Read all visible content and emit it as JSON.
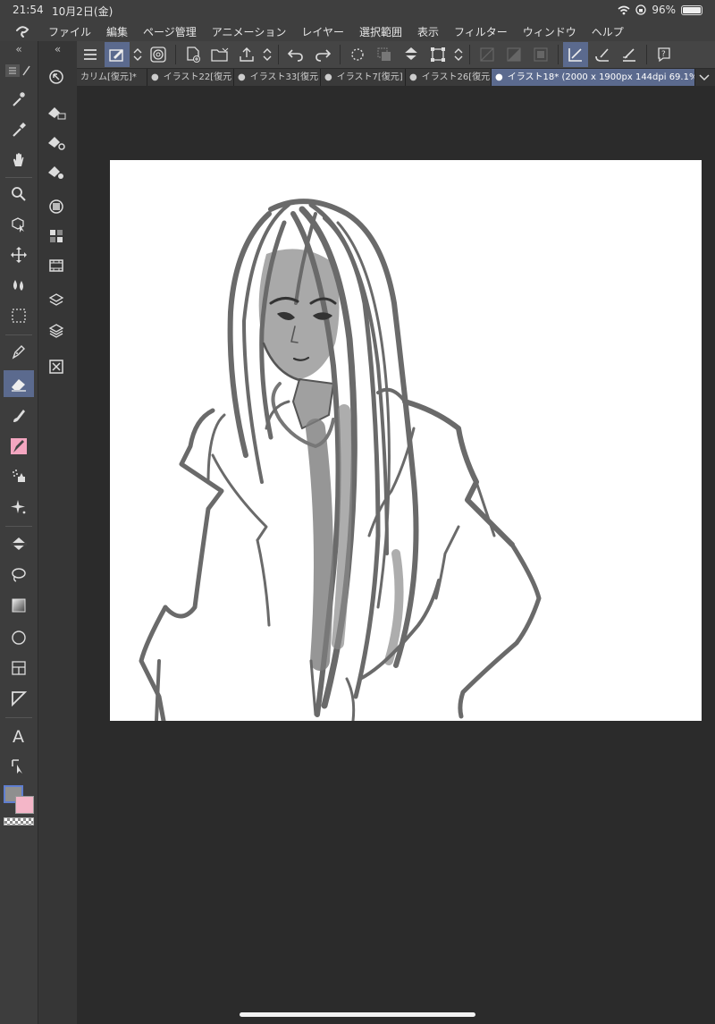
{
  "status_bar": {
    "time": "21:54",
    "date": "10月2日(金)",
    "battery": "96%",
    "battery_level": 0.96
  },
  "menu": {
    "items": [
      "ファイル",
      "編集",
      "ページ管理",
      "アニメーション",
      "レイヤー",
      "選択範囲",
      "表示",
      "フィルター",
      "ウィンドウ",
      "ヘルプ"
    ]
  },
  "panels": {
    "collapse_left": "«",
    "collapse_second": "«"
  },
  "tabs": [
    {
      "label": "カリム[復元]*",
      "dot": ""
    },
    {
      "label": "イラスト22[復元",
      "dot": "●"
    },
    {
      "label": "イラスト33[復元",
      "dot": "●"
    },
    {
      "label": "イラスト7[復元]",
      "dot": "●"
    },
    {
      "label": "イラスト26[復元",
      "dot": "●"
    },
    {
      "label": "イラスト18* (2000 x 1900px 144dpi 69.1%)",
      "dot": "●"
    }
  ],
  "colors": {
    "accent": "#5b6a8e",
    "main_color": "#8f8f8f",
    "sub_color": "#f4b6c8"
  },
  "tools": [
    "magic-wand-icon",
    "eyedropper-icon",
    "hand-icon",
    "zoom-icon",
    "object-select-icon",
    "move-icon",
    "blend-icon",
    "selection-icon",
    "pen-icon",
    "eraser-icon",
    "brush-icon",
    "decoration-icon",
    "airbrush-icon",
    "sparkle-icon",
    "fill-icon",
    "lasso-icon",
    "gradient-icon",
    "ellipse-icon",
    "frame-icon",
    "ruler-icon",
    "text-icon",
    "balloon-icon"
  ]
}
